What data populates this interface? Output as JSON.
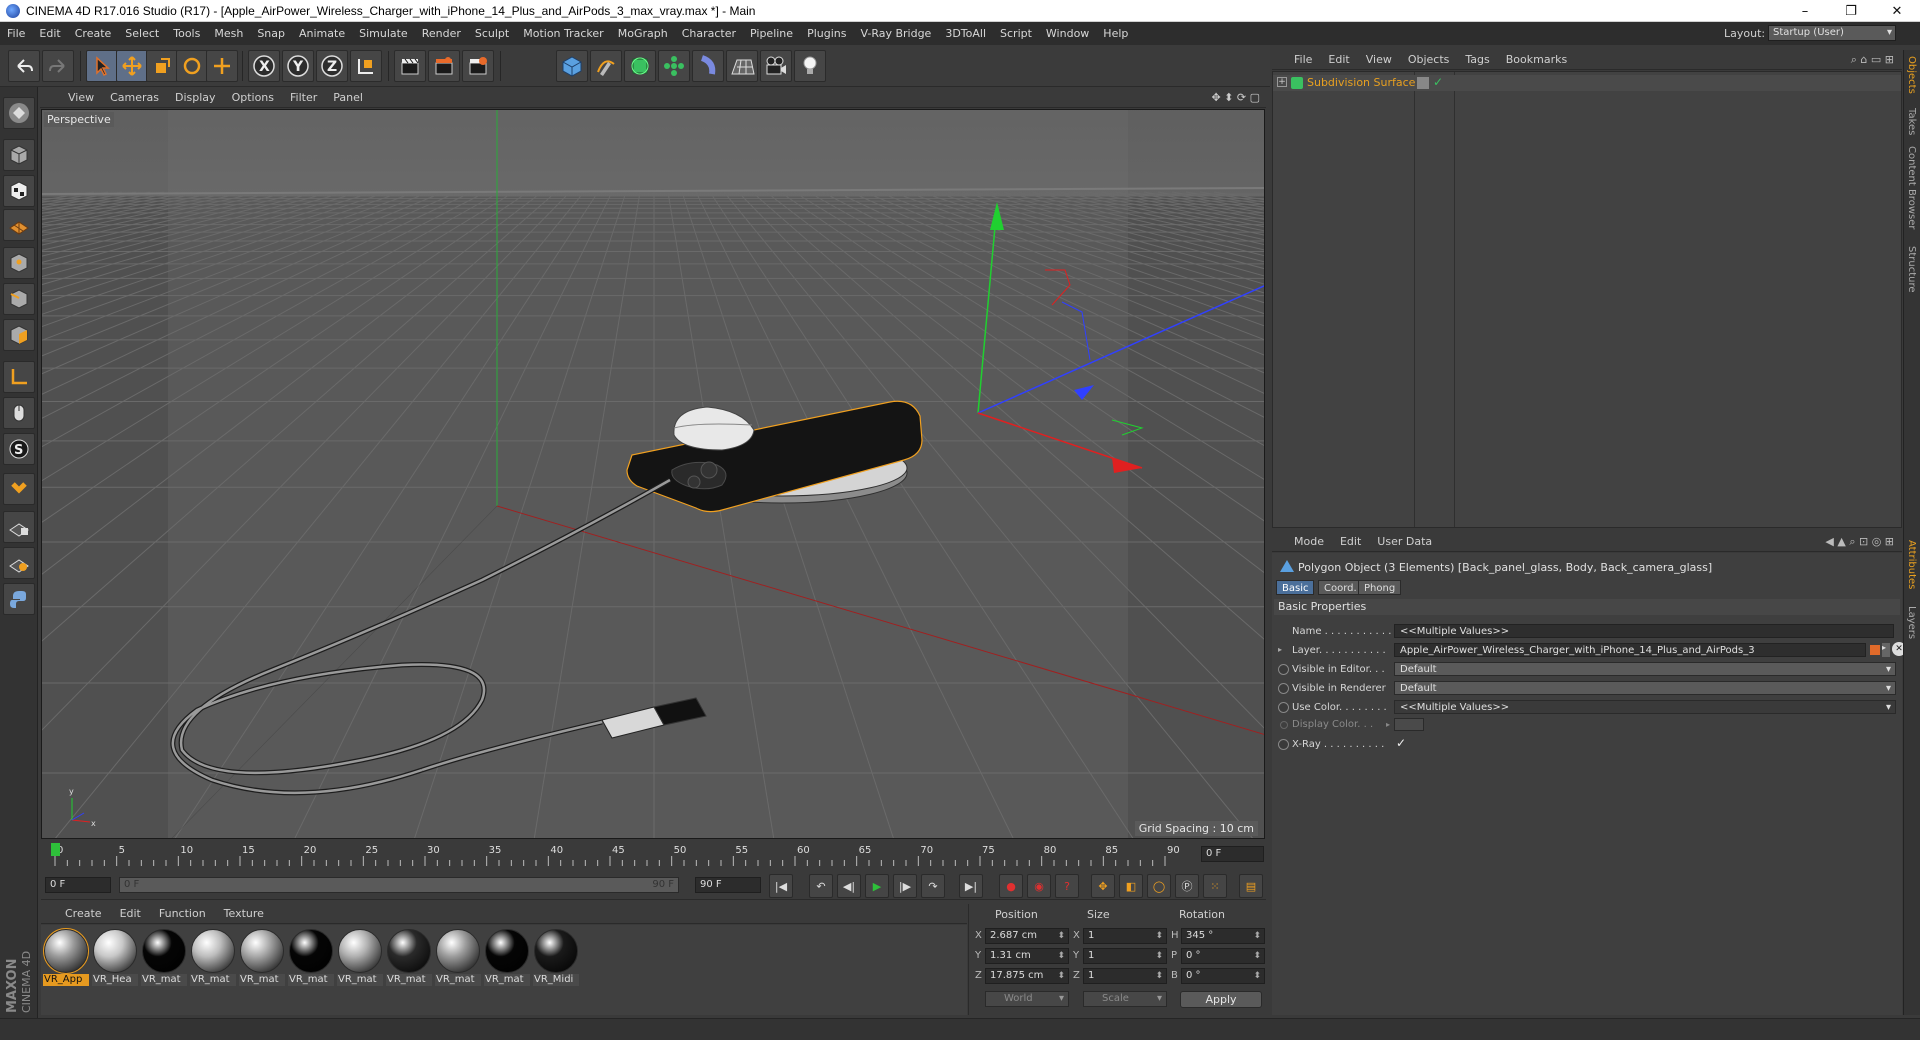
{
  "window": {
    "title": "CINEMA 4D R17.016 Studio (R17) - [Apple_AirPower_Wireless_Charger_with_iPhone_14_Plus_and_AirPods_3_max_vray.max *] - Main",
    "minimize": "–",
    "maximize": "❐",
    "close": "✕"
  },
  "menubar": {
    "items": [
      "File",
      "Edit",
      "Create",
      "Select",
      "Tools",
      "Mesh",
      "Snap",
      "Animate",
      "Simulate",
      "Render",
      "Sculpt",
      "Motion Tracker",
      "MoGraph",
      "Character",
      "Pipeline",
      "Plugins",
      "V-Ray Bridge",
      "3DToAll",
      "Script",
      "Window",
      "Help"
    ],
    "layout_label": "Layout:",
    "layout_value": "Startup (User)"
  },
  "viewport": {
    "menu": [
      "View",
      "Cameras",
      "Display",
      "Options",
      "Filter",
      "Panel"
    ],
    "label": "Perspective",
    "grid_spacing": "Grid Spacing : 10 cm"
  },
  "timeline": {
    "ticks": [
      "0",
      "5",
      "10",
      "15",
      "20",
      "25",
      "30",
      "35",
      "40",
      "45",
      "50",
      "55",
      "60",
      "65",
      "70",
      "75",
      "80",
      "85",
      "90"
    ],
    "current_frame": "0 F",
    "start_field": "0 F",
    "range_start": "0 F",
    "range_end": "90 F",
    "end_field": "90 F"
  },
  "material_manager": {
    "menu": [
      "Create",
      "Edit",
      "Function",
      "Texture"
    ],
    "materials": [
      {
        "label": "VR_App",
        "color": "#9a9a9a",
        "selected": true
      },
      {
        "label": "VR_Hea",
        "color": "#c8c8c8",
        "selected": false
      },
      {
        "label": "VR_mat",
        "color": "#050505",
        "selected": false
      },
      {
        "label": "VR_mat",
        "color": "#bdbdbd",
        "selected": false
      },
      {
        "label": "VR_mat",
        "color": "#a8a8a8",
        "selected": false
      },
      {
        "label": "VR_mat",
        "color": "#050505",
        "selected": false
      },
      {
        "label": "VR_mat",
        "color": "#b0b0b0",
        "selected": false
      },
      {
        "label": "VR_mat",
        "color": "#2a2a2a",
        "selected": false
      },
      {
        "label": "VR_mat",
        "color": "#9c9c9c",
        "selected": false
      },
      {
        "label": "VR_mat",
        "color": "#050505",
        "selected": false
      },
      {
        "label": "VR_Midi",
        "color": "#1a1a1a",
        "selected": false
      }
    ]
  },
  "coordinates": {
    "headers": {
      "position": "Position",
      "size": "Size",
      "rotation": "Rotation"
    },
    "rows": [
      {
        "axis": "X",
        "pos": "2.687 cm",
        "size_axis": "X",
        "size": "1",
        "rot_axis": "H",
        "rot": "345 °"
      },
      {
        "axis": "Y",
        "pos": "1.31 cm",
        "size_axis": "Y",
        "size": "1",
        "rot_axis": "P",
        "rot": "0 °"
      },
      {
        "axis": "Z",
        "pos": "17.875 cm",
        "size_axis": "Z",
        "size": "1",
        "rot_axis": "B",
        "rot": "0 °"
      }
    ],
    "space": "World",
    "mode": "Scale",
    "apply": "Apply"
  },
  "object_manager": {
    "menu": [
      "File",
      "Edit",
      "View",
      "Objects",
      "Tags",
      "Bookmarks"
    ],
    "objects": [
      {
        "name": "Subdivision Surface"
      }
    ]
  },
  "attributes": {
    "menu": [
      "Mode",
      "Edit",
      "User Data"
    ],
    "title": "Polygon Object (3 Elements) [Back_panel_glass, Body, Back_camera_glass]",
    "tabs": [
      "Basic",
      "Coord.",
      "Phong"
    ],
    "section": "Basic Properties",
    "fields": {
      "name_label": "Name . . . . . . . . . . .",
      "name_value": "<<Multiple Values>>",
      "layer_label": "Layer. . . . . . . . . . .",
      "layer_value": "Apple_AirPower_Wireless_Charger_with_iPhone_14_Plus_and_AirPods_3",
      "vis_editor_label": "Visible in Editor. . .",
      "vis_editor_value": "Default",
      "vis_render_label": "Visible in Renderer",
      "vis_render_value": "Default",
      "use_color_label": "Use Color. . . . . . . .",
      "use_color_value": "<<Multiple Values>>",
      "display_color_label": "Display Color. . .",
      "xray_label": "X-Ray . . . . . . . . . .",
      "xray_check": "✓"
    }
  },
  "side_tabs": [
    "Objects",
    "Takes",
    "Content Browser",
    "Structure",
    "Attributes",
    "Layers"
  ],
  "brand": {
    "maxon": "MAXON",
    "c4d": "CINEMA 4D"
  }
}
